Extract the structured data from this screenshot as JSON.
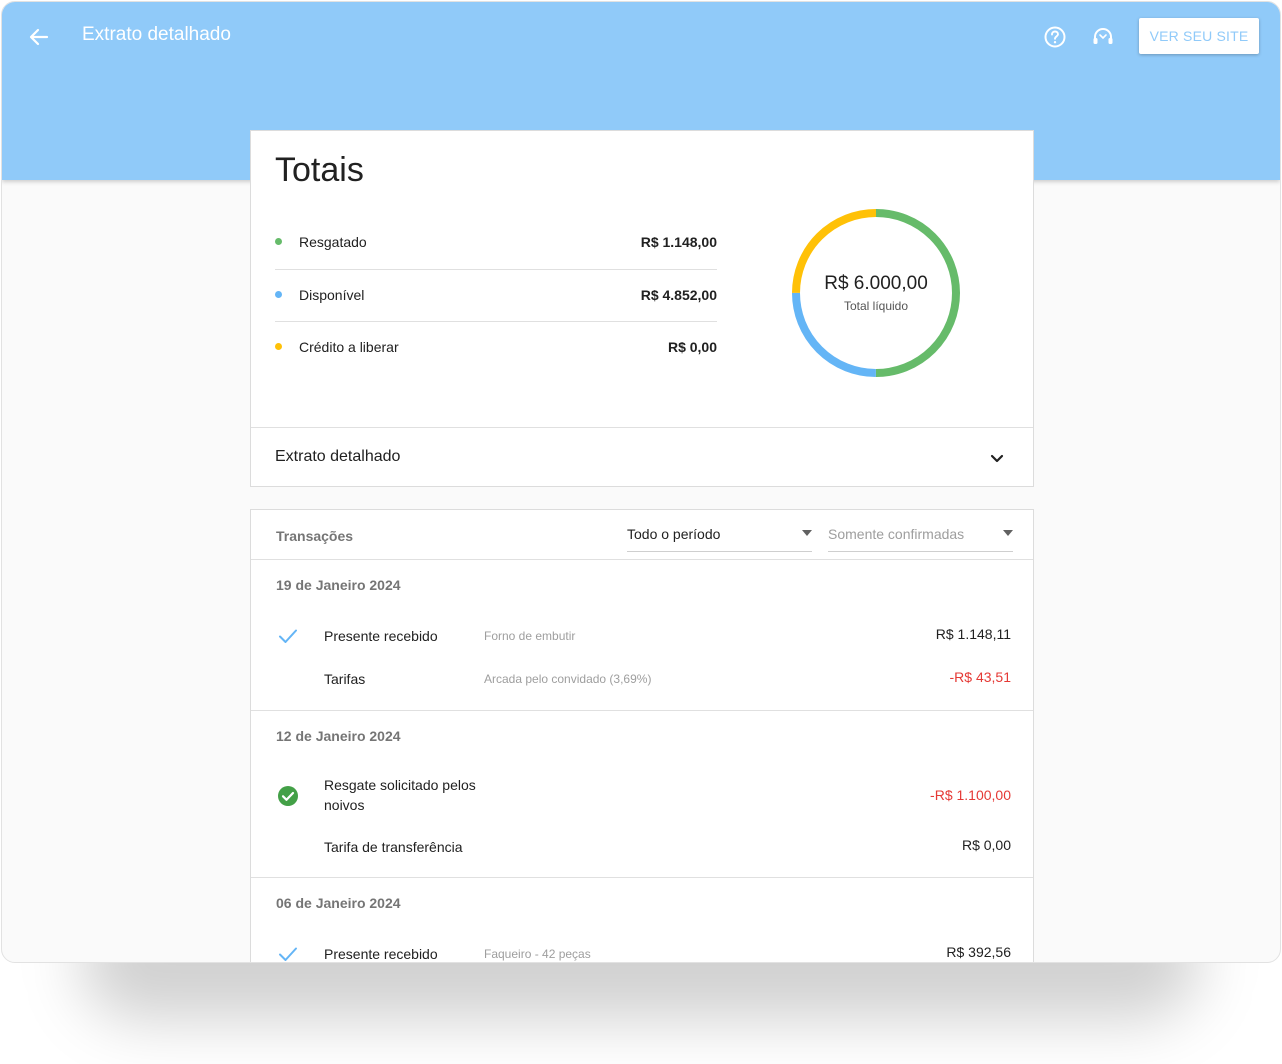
{
  "header": {
    "title": "Extrato detalhado",
    "site_button": "VER SEU SITE"
  },
  "colors": {
    "header_bg": "#90caf9",
    "green": "#66bb6a",
    "blue": "#64b5f6",
    "yellow": "#ffc107",
    "negative": "#e53935"
  },
  "totals": {
    "title": "Totais",
    "items": [
      {
        "label": "Resgatado",
        "value": "R$ 1.148,00",
        "color": "#66bb6a"
      },
      {
        "label": "Disponível",
        "value": "R$ 4.852,00",
        "color": "#64b5f6"
      },
      {
        "label": "Crédito a liberar",
        "value": "R$ 0,00",
        "color": "#ffc107"
      }
    ],
    "donut": {
      "center_value": "R$ 6.000,00",
      "center_label": "Total líquido",
      "segments": [
        {
          "name": "green",
          "fraction": 0.5,
          "color": "#66bb6a"
        },
        {
          "name": "blue",
          "fraction": 0.25,
          "color": "#64b5f6"
        },
        {
          "name": "yellow",
          "fraction": 0.25,
          "color": "#ffc107"
        }
      ]
    },
    "extrato_label": "Extrato detalhado"
  },
  "transactions": {
    "header_label": "Transações",
    "period_filter": "Todo o período",
    "status_filter": "Somente confirmadas",
    "groups": [
      {
        "date": "19 de Janeiro 2024",
        "items": [
          {
            "title": "Presente recebido",
            "desc": "Forno de embutir",
            "amount": "R$ 1.148,11",
            "icon": "check-icon"
          },
          {
            "title": "Tarifas",
            "desc": "Arcada pelo convidado (3,69%)",
            "amount": "-R$ 43,51"
          }
        ]
      },
      {
        "date": "12 de Janeiro 2024",
        "items": [
          {
            "title_line1": "Resgate solicitado pelos",
            "title_line2": "noivos",
            "amount": "-R$ 1.100,00",
            "icon": "check-circle-icon"
          },
          {
            "title": "Tarifa de transferência",
            "amount": "R$ 0,00"
          }
        ]
      },
      {
        "date": "06 de Janeiro 2024",
        "items": [
          {
            "title": "Presente recebido",
            "desc": "Faqueiro - 42 peças",
            "amount": "R$ 392,56",
            "icon": "check-icon"
          }
        ]
      }
    ]
  }
}
